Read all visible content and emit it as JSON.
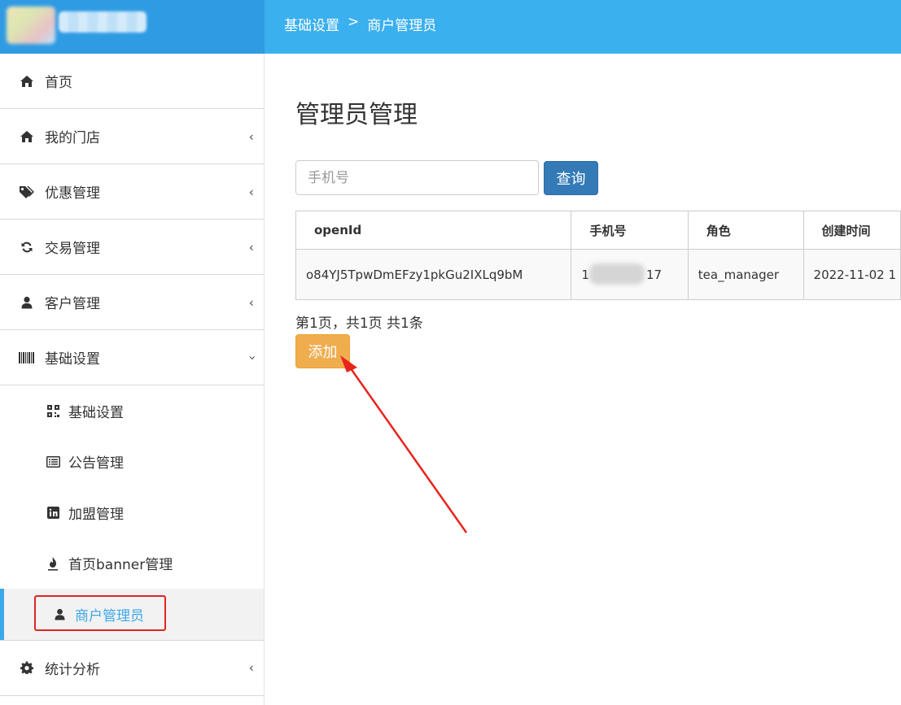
{
  "header": {
    "breadcrumb": [
      "基础设置",
      ">",
      "商户管理员"
    ],
    "bg_color": "#3bb0ee"
  },
  "sidebar": {
    "items": [
      {
        "label": "首页",
        "icon": "home-icon",
        "has_chevron": false
      },
      {
        "label": "我的门店",
        "icon": "home-icon",
        "has_chevron": true
      },
      {
        "label": "优惠管理",
        "icon": "tags-icon",
        "has_chevron": true
      },
      {
        "label": "交易管理",
        "icon": "refresh-icon",
        "has_chevron": true
      },
      {
        "label": "客户管理",
        "icon": "user-icon",
        "has_chevron": true
      },
      {
        "label": "基础设置",
        "icon": "barcode-icon",
        "has_chevron": true,
        "expanded": true
      }
    ],
    "sub_items": [
      {
        "label": "基础设置",
        "icon": "qrcode-icon"
      },
      {
        "label": "公告管理",
        "icon": "list-alt-icon"
      },
      {
        "label": "加盟管理",
        "icon": "linkedin-icon"
      },
      {
        "label": "首页banner管理",
        "icon": "fire-icon"
      },
      {
        "label": "商户管理员",
        "icon": "user-icon",
        "active": true
      }
    ],
    "after_items": [
      {
        "label": "统计分析",
        "icon": "gear-icon",
        "has_chevron": true
      }
    ],
    "active_color": "#3ba8e8"
  },
  "main": {
    "title": "管理员管理",
    "search": {
      "placeholder": "手机号",
      "value": ""
    },
    "query_label": "查询",
    "table": {
      "columns": [
        "openId",
        "手机号",
        "角色",
        "创建时间"
      ],
      "rows": [
        {
          "openId": "o84YJ5TpwDmEFzy1pkGu2IXLq9bM",
          "phone_prefix": "1",
          "phone_suffix": "17",
          "role": "tea_manager",
          "created": "2022-11-02 1"
        }
      ]
    },
    "pager_text": "第1页，共1页 共1条",
    "add_label": "添加",
    "add_color": "#f0ad4e",
    "query_color": "#337ab7"
  }
}
